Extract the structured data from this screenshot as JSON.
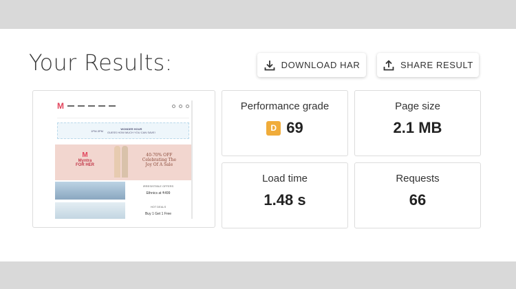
{
  "page": {
    "title": "Your Results:"
  },
  "actions": {
    "download_label": "DOWNLOAD HAR",
    "share_label": "SHARE RESULT"
  },
  "metrics": {
    "performance": {
      "label": "Performance grade",
      "grade": "D",
      "value": "69"
    },
    "page_size": {
      "label": "Page size",
      "value": "2.1 MB"
    },
    "load_time": {
      "label": "Load time",
      "value": "1.48 s"
    },
    "requests": {
      "label": "Requests",
      "value": "66"
    }
  },
  "colors": {
    "grade_d": "#f0ac3a",
    "band_gray": "#d9d9d9"
  },
  "thumbnail": {
    "banner_left": "1PM-3PM",
    "banner_title": "WONDER HOUR",
    "banner_sub": "GUESS HOW MUCH YOU CAN SAVE!",
    "brand": "Myntra",
    "brand_sub": "FOR HER",
    "offer_line1": "40-70% OFF",
    "offer_line2": "Celebrating The",
    "offer_line3": "Joy Of A Sale",
    "ethnic_head": "IRRESISTIBLE OFFERS",
    "ethnic_text": "Ethnics at ₹499",
    "fest_head": "HOT DEALS",
    "fest_text": "Buy 1 Get 1 Free"
  }
}
